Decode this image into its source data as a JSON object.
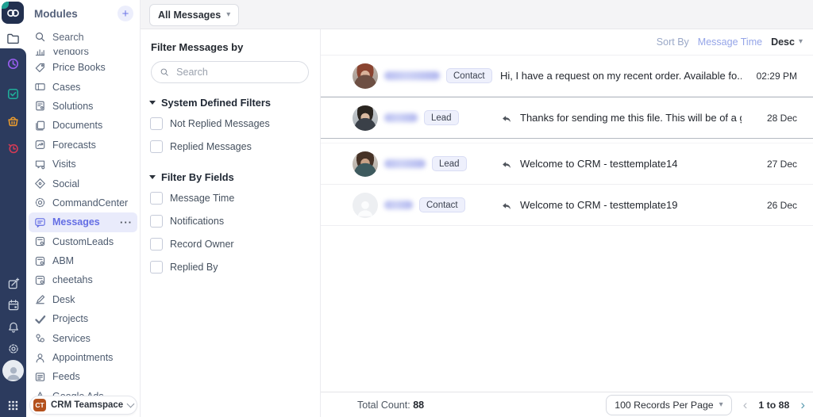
{
  "header": {
    "view_selector": "All Messages"
  },
  "sidebar": {
    "title": "Modules",
    "add_label": "+",
    "search_label": "Search",
    "more_icon": "···",
    "items": [
      {
        "label": "Vendors"
      },
      {
        "label": "Price Books"
      },
      {
        "label": "Cases"
      },
      {
        "label": "Solutions"
      },
      {
        "label": "Documents"
      },
      {
        "label": "Forecasts"
      },
      {
        "label": "Visits"
      },
      {
        "label": "Social"
      },
      {
        "label": "CommandCenter"
      },
      {
        "label": "Messages"
      },
      {
        "label": "CustomLeads"
      },
      {
        "label": "ABM"
      },
      {
        "label": "cheetahs"
      },
      {
        "label": "Desk"
      },
      {
        "label": "Projects"
      },
      {
        "label": "Services"
      },
      {
        "label": "Appointments"
      },
      {
        "label": "Feeds"
      },
      {
        "label": "Google Ads"
      }
    ],
    "teamspace": {
      "initials": "CT",
      "name": "CRM Teamspace"
    }
  },
  "filter": {
    "title": "Filter Messages by",
    "search_placeholder": "Search",
    "sections": [
      {
        "title": "System Defined Filters",
        "options": [
          "Not Replied Messages",
          "Replied Messages"
        ]
      },
      {
        "title": "Filter By Fields",
        "options": [
          "Message Time",
          "Notifications",
          "Record Owner",
          "Replied By"
        ]
      }
    ]
  },
  "list": {
    "sort_by_label": "Sort By",
    "sort_field": "Message Time",
    "sort_order": "Desc",
    "rows": [
      {
        "badge": "Contact",
        "replied": false,
        "message": "Hi, I have a request on my recent order. Available fo...",
        "time": "02:29 PM"
      },
      {
        "badge": "Lead",
        "replied": true,
        "message": "Thanks for sending me this file. This will be of a gre...",
        "time": "28 Dec"
      },
      {
        "badge": "Lead",
        "replied": true,
        "message": "Welcome to CRM - testtemplate14",
        "time": "27 Dec"
      },
      {
        "badge": "Contact",
        "replied": true,
        "message": "Welcome to CRM - testtemplate19",
        "time": "26 Dec"
      }
    ]
  },
  "footer": {
    "total_label": "Total Count: ",
    "total_value": "88",
    "per_page": "100 Records Per Page",
    "prev": "‹",
    "range": "1 to 88",
    "next": "›"
  },
  "colors": {
    "accent": "#646ee4",
    "rail": "#2c3b5e",
    "active_bg": "#e9ebfb",
    "teamspace_badge": "#b4511d"
  }
}
